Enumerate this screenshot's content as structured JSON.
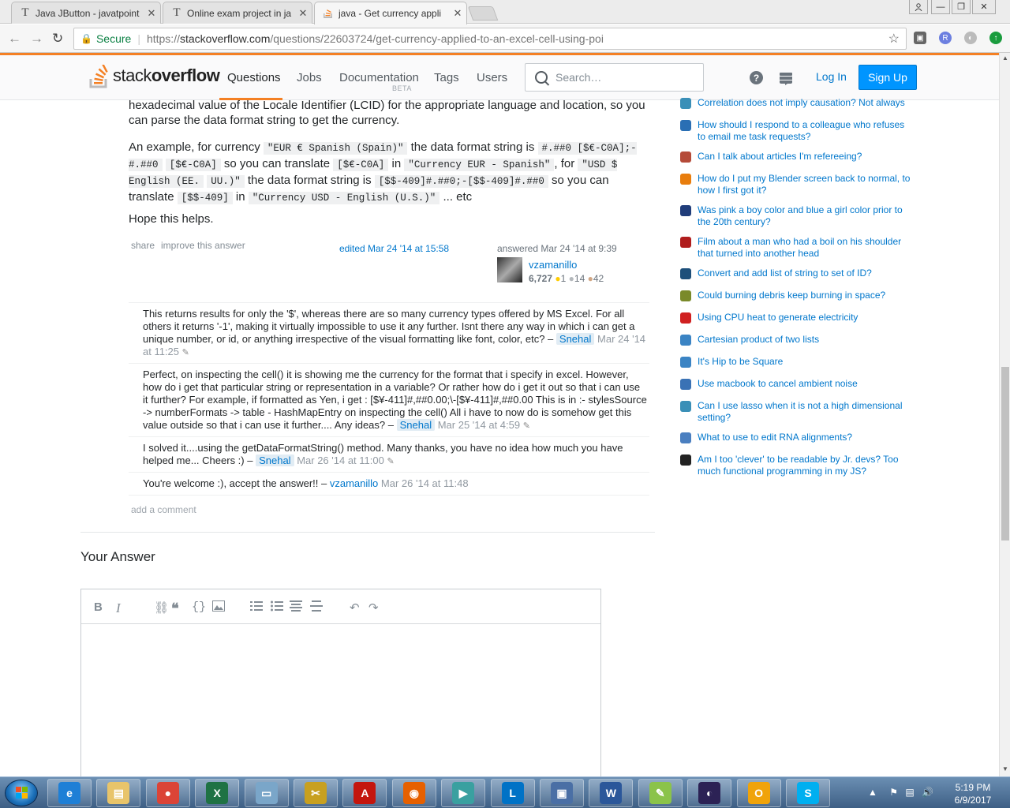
{
  "browser": {
    "tabs": [
      {
        "title": "Java JButton - javatpoint",
        "favicon": "T"
      },
      {
        "title": "Online exam project in ja",
        "favicon": "T"
      },
      {
        "title": "java - Get currency appli",
        "favicon": "so-icon"
      }
    ],
    "address": {
      "secure_label": "Secure",
      "url_scheme": "https://",
      "url_host": "stackoverflow.com",
      "url_path": "/questions/22603724/get-currency-applied-to-an-excel-cell-using-poi"
    }
  },
  "so_header": {
    "logo_text_a": "stack",
    "logo_text_b": "overflow",
    "nav": [
      "Questions",
      "Jobs",
      "Documentation",
      "Tags",
      "Users"
    ],
    "beta_label": "BETA",
    "search_placeholder": "Search…",
    "login": "Log In",
    "signup": "Sign Up",
    "accent": "#f48024",
    "link_color": "#0077cc"
  },
  "answer": {
    "para1": "hexadecimal value of the Locale Identifier (LCID) for the appropriate language and location, so you can parse the data format string to get the currency.",
    "ex_intro": "An example, for currency",
    "code1": "\"EUR € Spanish (Spain)\"",
    "ex_mid1": "the data format string is",
    "code2": "#.##0 [$€-C0A];-#.##0",
    "code3": "[$€-C0A]",
    "ex_mid2": "so you can translate",
    "code4": "[$€-C0A]",
    "ex_in": "in",
    "code5": "\"Currency EUR - Spanish\"",
    "ex_for": ", for",
    "code6": "\"USD $ English (EE.",
    "code7": "UU.)\"",
    "ex_mid3": "the data format string is",
    "code8": "[$$-409]#.##0;-[$$-409]#.##0",
    "ex_mid4": "so you can translate",
    "code9": "[$$-409]",
    "ex_in2": "in",
    "code10": "\"Currency USD - English (U.S.)\"",
    "ex_end": "... etc",
    "para3": "Hope this helps.",
    "share": "share",
    "improve": "improve this answer",
    "edited": "edited Mar 24 '14 at 15:58",
    "answered": "answered Mar 24 '14 at 9:39",
    "user": "vzamanillo",
    "rep": "6,727",
    "gold": "1",
    "silver": "14",
    "bronze": "42"
  },
  "comments": [
    {
      "text": "This returns results for only the '$', whereas there are so many currency types offered by MS Excel. For all others it returns '-1', making it virtually impossible to use it any further. Isnt there any way in which i can get a unique number, or id, or anything irrespective of the visual formatting like font, color, etc? –",
      "user": "Snehal",
      "date": "Mar 24 '14 at 11:25"
    },
    {
      "text": "Perfect, on inspecting the cell() it is showing me the currency for the format that i specify in excel. However, how do i get that particular string or representation in a variable? Or rather how do i get it out so that i can use it further? For example, if formatted as Yen, i get : [$¥-411]#,##0.00;\\-[$¥-411]#,##0.00 This is in :- stylesSource -> numberFormats -> table - HashMapEntry on inspecting the cell() All i have to now do is somehow get this value outside so that i can use it further.... Any ideas? –",
      "user": "Snehal",
      "date": "Mar 25 '14 at 4:59"
    },
    {
      "text": "I solved it....using the getDataFormatString() method. Many thanks, you have no idea how much you have helped me... Cheers :) –",
      "user": "Snehal",
      "date": "Mar 26 '14 at 11:00"
    },
    {
      "text": "You're welcome :), accept the answer!! –",
      "user": "vzamanillo",
      "date": "Mar 26 '14 at 11:48"
    }
  ],
  "add_comment": "add a comment",
  "your_answer": "Your Answer",
  "hot_questions": [
    {
      "title": "Correlation does not imply causation? Not always",
      "icon": "stats-icon",
      "color": "#3a8fb7"
    },
    {
      "title": "How should I respond to a colleague who refuses to email me task requests?",
      "icon": "workplace-icon",
      "color": "#2a6fb4"
    },
    {
      "title": "Can I talk about articles I'm refereeing?",
      "icon": "academia-icon",
      "color": "#b54b39"
    },
    {
      "title": "How do I put my Blender screen back to normal, to how I first got it?",
      "icon": "blender-icon",
      "color": "#e87d0d"
    },
    {
      "title": "Was pink a boy color and blue a girl color prior to the 20th century?",
      "icon": "skeptics-icon",
      "color": "#203d7a"
    },
    {
      "title": "Film about a man who had a boil on his shoulder that turned into another head",
      "icon": "movies-icon",
      "color": "#b01d1d"
    },
    {
      "title": "Convert and add list of string to set of ID?",
      "icon": "salesforce-icon",
      "color": "#1d4f7a"
    },
    {
      "title": "Could burning debris keep burning in space?",
      "icon": "space-icon",
      "color": "#7a8a2a"
    },
    {
      "title": "Using CPU heat to generate electricity",
      "icon": "electronics-icon",
      "color": "#d02020"
    },
    {
      "title": "Cartesian product of two lists",
      "icon": "codegolf-icon",
      "color": "#3b84c4"
    },
    {
      "title": "It's Hip to be Square",
      "icon": "codegolf-icon",
      "color": "#3b84c4"
    },
    {
      "title": "Use macbook to cancel ambient noise",
      "icon": "apple-icon",
      "color": "#3a72b5"
    },
    {
      "title": "Can I use lasso when it is not a high dimensional setting?",
      "icon": "stats-icon",
      "color": "#3a8fb7"
    },
    {
      "title": "What to use to edit RNA alignments?",
      "icon": "bioinformatics-icon",
      "color": "#4a7fc0"
    },
    {
      "title": "Am I too 'clever' to be readable by Jr. devs? Too much functional programming in my JS?",
      "icon": "softwareengineering-icon",
      "color": "#222222"
    }
  ],
  "editor_tools": [
    "bold-icon",
    "italic-icon",
    "link-icon",
    "quote-icon",
    "code-icon",
    "image-icon",
    "ordered-list-icon",
    "bullet-list-icon",
    "heading-icon",
    "hr-icon",
    "undo-icon",
    "redo-icon"
  ],
  "taskbar": {
    "apps": [
      "ie",
      "explorer",
      "chrome",
      "excel",
      "notepad",
      "tool",
      "acrobat",
      "firefox",
      "media",
      "lync",
      "network",
      "word",
      "notepadpp",
      "eclipse",
      "outlook",
      "skype"
    ],
    "time": "5:19 PM",
    "date": "6/9/2017"
  }
}
